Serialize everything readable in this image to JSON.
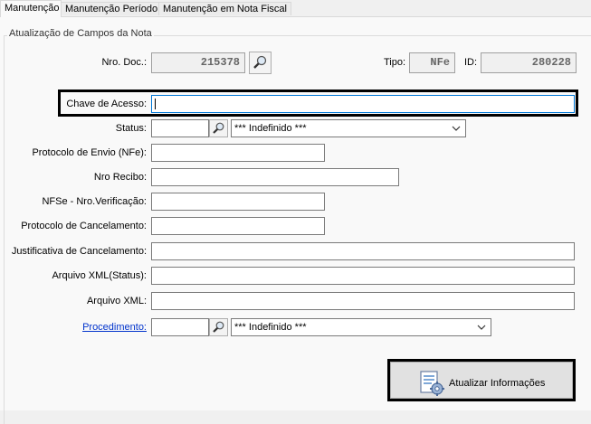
{
  "tabs": [
    {
      "label": "Manutenção",
      "active": true
    },
    {
      "label": "Manutenção Período",
      "active": false
    },
    {
      "label": "Manutenção em Nota Fiscal",
      "active": false
    }
  ],
  "group_title": "Atualização de Campos da Nota",
  "nro_doc": {
    "label": "Nro. Doc.:",
    "value": "215378"
  },
  "tipo": {
    "label": "Tipo:",
    "value": "NFe"
  },
  "id": {
    "label": "ID:",
    "value": "280228"
  },
  "chave_acesso": {
    "label": "Chave de Acesso:",
    "value": ""
  },
  "status": {
    "label": "Status:",
    "code": "",
    "selected": "*** Indefinido ***"
  },
  "protocolo_envio": {
    "label": "Protocolo de Envio (NFe):",
    "value": ""
  },
  "nro_recibo": {
    "label": "Nro Recibo:",
    "value": ""
  },
  "nfse_verificacao": {
    "label": "NFSe - Nro.Verificação:",
    "value": ""
  },
  "protocolo_cancelamento": {
    "label": "Protocolo de Cancelamento:",
    "value": ""
  },
  "justificativa_cancelamento": {
    "label": "Justificativa de Cancelamento:",
    "value": ""
  },
  "arquivo_xml_status": {
    "label": "Arquivo XML(Status):",
    "value": ""
  },
  "arquivo_xml": {
    "label": "Arquivo XML:",
    "value": ""
  },
  "procedimento": {
    "label": "Procedimento:",
    "code": "",
    "selected": "*** Indefinido ***"
  },
  "update_button": {
    "label": "Atualizar Informações"
  },
  "colors": {
    "link": "#0033cc",
    "focus_border": "#0078d7"
  }
}
